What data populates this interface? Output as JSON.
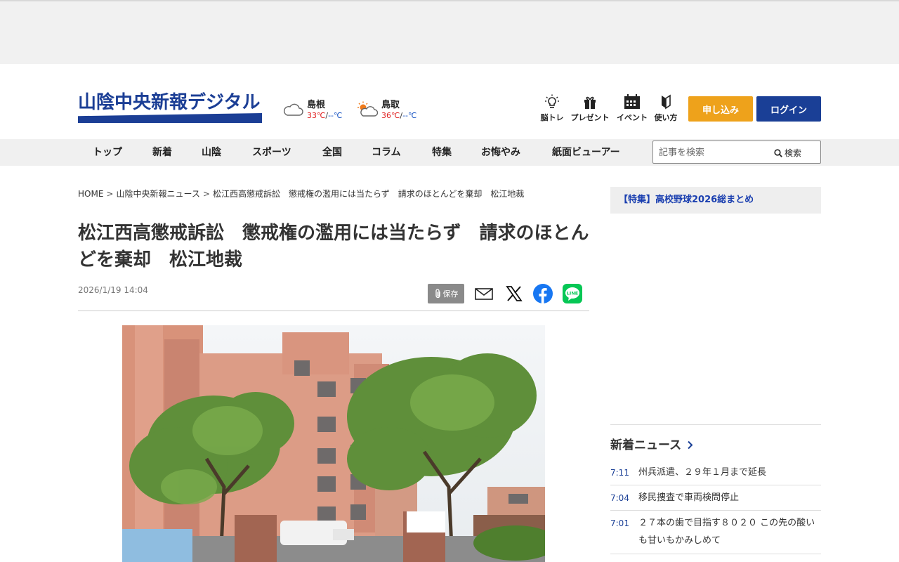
{
  "header": {
    "logo_text": "山陰中央新報デジタル",
    "weather": [
      {
        "city": "島根",
        "high": "33℃",
        "sep": "/",
        "low": "--℃",
        "icon": "cloudy-icon"
      },
      {
        "city": "鳥取",
        "high": "36℃",
        "sep": "/",
        "low": "--℃",
        "icon": "sun-cloud-icon"
      }
    ],
    "icons": [
      {
        "label": "脳トレ",
        "icon": "lightbulb-icon"
      },
      {
        "label": "プレゼント",
        "icon": "gift-icon"
      },
      {
        "label": "イベント",
        "icon": "calendar-icon"
      },
      {
        "label": "使い方",
        "icon": "beginner-mark-icon"
      }
    ],
    "apply_label": "申し込み",
    "login_label": "ログイン",
    "colors": {
      "brand": "#1b3e95",
      "apply": "#eea21b",
      "login": "#1a3f96"
    }
  },
  "nav": {
    "items": [
      "トップ",
      "新着",
      "山陰",
      "スポーツ",
      "全国",
      "コラム",
      "特集",
      "お悔やみ",
      "紙面ビューアー"
    ],
    "search_placeholder": "記事を検索",
    "search_button": "検索"
  },
  "article": {
    "breadcrumb": [
      "HOME",
      "山陰中央新報ニュース",
      "松江西高懲戒訴訟　懲戒権の濫用には当たらず　請求のほとんどを棄却　松江地裁"
    ],
    "breadcrumb_sep": ">",
    "title": "松江西高懲戒訴訟　懲戒権の濫用には当たらず　請求のほとんどを棄却　松江地裁",
    "date": "2026/1/19 14:04",
    "save_label": "保存",
    "share_icons": [
      "mail-icon",
      "x-icon",
      "facebook-icon",
      "line-icon"
    ],
    "line_label": "LINE"
  },
  "sidebar": {
    "feature_link": "【特集】高校野球2026総まとめ",
    "news_heading": "新着ニュース",
    "news": [
      {
        "time": "7:11",
        "text": "州兵派遣、２９年１月まで延長"
      },
      {
        "time": "7:04",
        "text": "移民捜査で車両検問停止"
      },
      {
        "time": "7:01",
        "text": "２７本の歯で目指す８０２０ この先の酸いも甘いもかみしめて"
      }
    ]
  }
}
